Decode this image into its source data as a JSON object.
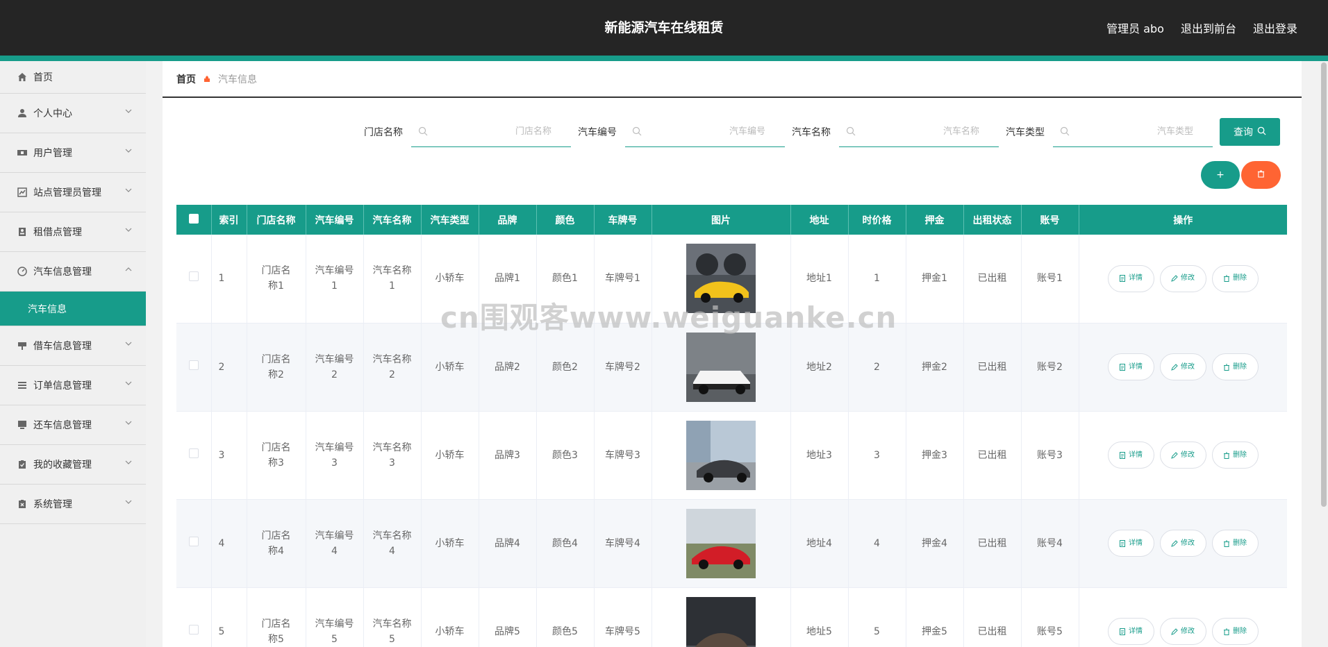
{
  "header": {
    "title": "新能源汽车在线租赁",
    "user": "管理员 abo",
    "front_link": "退出到前台",
    "logout_link": "退出登录"
  },
  "sidebar": {
    "items": [
      {
        "label": "首页",
        "icon": "home-icon",
        "chevron": false
      },
      {
        "label": "个人中心",
        "icon": "user-icon",
        "chevron": true
      },
      {
        "label": "用户管理",
        "icon": "ticket-icon",
        "chevron": true
      },
      {
        "label": "站点管理员管理",
        "icon": "chart-icon",
        "chevron": true
      },
      {
        "label": "租借点管理",
        "icon": "person-badge-icon",
        "chevron": true
      },
      {
        "label": "汽车信息管理",
        "icon": "dashboard-icon",
        "chevron": true,
        "expanded": true
      },
      {
        "label": "借车信息管理",
        "icon": "sign-icon",
        "chevron": true
      },
      {
        "label": "订单信息管理",
        "icon": "list-icon",
        "chevron": true
      },
      {
        "label": "还车信息管理",
        "icon": "monitor-icon",
        "chevron": true
      },
      {
        "label": "我的收藏管理",
        "icon": "clipboard-check-icon",
        "chevron": true
      },
      {
        "label": "系统管理",
        "icon": "clipboard-x-icon",
        "chevron": true
      }
    ],
    "active_submenu": "汽车信息"
  },
  "breadcrumb": {
    "home": "首页",
    "current": "汽车信息"
  },
  "search": {
    "fields": [
      {
        "label": "门店名称",
        "placeholder": "门店名称"
      },
      {
        "label": "汽车编号",
        "placeholder": "汽车编号"
      },
      {
        "label": "汽车名称",
        "placeholder": "汽车名称"
      },
      {
        "label": "汽车类型",
        "placeholder": "汽车类型"
      }
    ],
    "query_label": "查询"
  },
  "actions": {
    "add_label": "+"
  },
  "colors": {
    "accent": "#179c8a",
    "danger": "#ff6433",
    "header_bg": "#252525"
  },
  "table": {
    "headers": [
      "索引",
      "门店名称",
      "汽车编号",
      "汽车名称",
      "汽车类型",
      "品牌",
      "颜色",
      "车牌号",
      "图片",
      "地址",
      "时价格",
      "押金",
      "出租状态",
      "账号",
      "操作"
    ],
    "op_labels": {
      "detail": "详情",
      "edit": "修改",
      "delete": "删除"
    },
    "rows": [
      {
        "index": "1",
        "store": "门店名称1",
        "car_no": "汽车编号1",
        "car_name": "汽车名称1",
        "type": "小轿车",
        "brand": "品牌1",
        "color": "颜色1",
        "plate": "车牌号1",
        "address": "地址1",
        "price": "1",
        "deposit": "押金1",
        "status": "已出租",
        "account": "账号1"
      },
      {
        "index": "2",
        "store": "门店名称2",
        "car_no": "汽车编号2",
        "car_name": "汽车名称2",
        "type": "小轿车",
        "brand": "品牌2",
        "color": "颜色2",
        "plate": "车牌号2",
        "address": "地址2",
        "price": "2",
        "deposit": "押金2",
        "status": "已出租",
        "account": "账号2"
      },
      {
        "index": "3",
        "store": "门店名称3",
        "car_no": "汽车编号3",
        "car_name": "汽车名称3",
        "type": "小轿车",
        "brand": "品牌3",
        "color": "颜色3",
        "plate": "车牌号3",
        "address": "地址3",
        "price": "3",
        "deposit": "押金3",
        "status": "已出租",
        "account": "账号3"
      },
      {
        "index": "4",
        "store": "门店名称4",
        "car_no": "汽车编号4",
        "car_name": "汽车名称4",
        "type": "小轿车",
        "brand": "品牌4",
        "color": "颜色4",
        "plate": "车牌号4",
        "address": "地址4",
        "price": "4",
        "deposit": "押金4",
        "status": "已出租",
        "account": "账号4"
      },
      {
        "index": "5",
        "store": "门店名称5",
        "car_no": "汽车编号5",
        "car_name": "汽车名称5",
        "type": "小轿车",
        "brand": "品牌5",
        "color": "颜色5",
        "plate": "车牌号5",
        "address": "地址5",
        "price": "5",
        "deposit": "押金5",
        "status": "已出租",
        "account": "账号5"
      }
    ]
  },
  "watermark": "cn围观客www.weiguanke.cn"
}
